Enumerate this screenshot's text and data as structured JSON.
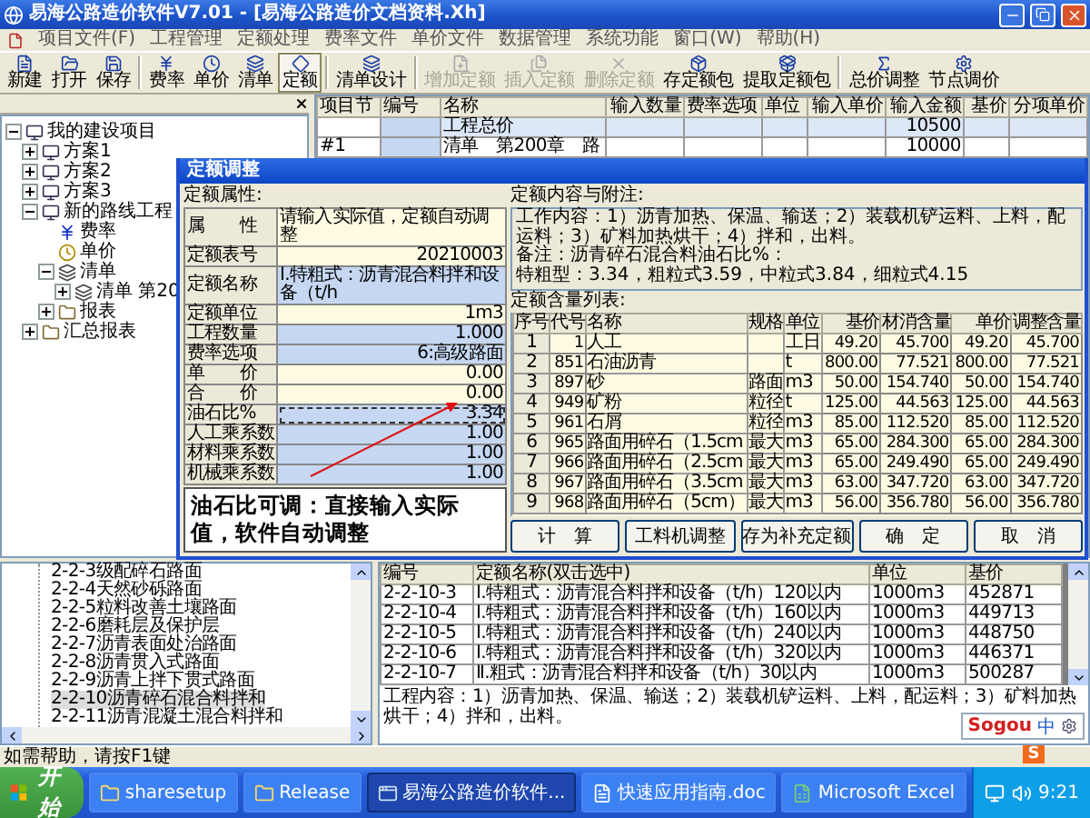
{
  "window": {
    "title": "易海公路造价软件V7.01 - [易海公路造价文档资料.Xh]"
  },
  "menu": [
    "项目文件(F)",
    "工程管理",
    "定额处理",
    "费率文件",
    "单价文件",
    "数据管理",
    "系统功能",
    "窗口(W)",
    "帮助(H)"
  ],
  "toolbar": [
    [
      {
        "label": "新建",
        "kind": "new",
        "pressed": false,
        "disabled": false
      },
      {
        "label": "打开",
        "kind": "open",
        "pressed": false,
        "disabled": false
      },
      {
        "label": "保存",
        "kind": "save",
        "pressed": false,
        "disabled": false
      }
    ],
    [
      {
        "label": "费率",
        "kind": "rate",
        "pressed": false,
        "disabled": false
      },
      {
        "label": "单价",
        "kind": "price",
        "pressed": false,
        "disabled": false
      },
      {
        "label": "清单",
        "kind": "list",
        "pressed": false,
        "disabled": false
      },
      {
        "label": "定额",
        "kind": "quota",
        "pressed": true,
        "disabled": false
      }
    ],
    [
      {
        "label": "清单设计",
        "kind": "design",
        "pressed": false,
        "disabled": false
      }
    ],
    [
      {
        "label": "增加定额",
        "kind": "add",
        "pressed": false,
        "disabled": true
      },
      {
        "label": "插入定额",
        "kind": "insert",
        "pressed": false,
        "disabled": true
      },
      {
        "label": "删除定额",
        "kind": "delete",
        "pressed": false,
        "disabled": true
      },
      {
        "label": "存定额包",
        "kind": "store",
        "pressed": false,
        "disabled": false
      },
      {
        "label": "提取定额包",
        "kind": "extract",
        "pressed": false,
        "disabled": false
      }
    ],
    [
      {
        "label": "总价调整",
        "kind": "total",
        "pressed": false,
        "disabled": false
      },
      {
        "label": "节点调价",
        "kind": "node",
        "pressed": false,
        "disabled": false
      }
    ]
  ],
  "project_tree": [
    {
      "label": "我的建设项目",
      "kind": "project",
      "expanded": true,
      "children": [
        {
          "label": "方案1",
          "kind": "project",
          "expanded": false
        },
        {
          "label": "方案2",
          "kind": "project",
          "expanded": false
        },
        {
          "label": "方案3",
          "kind": "project",
          "expanded": false
        },
        {
          "label": "新的路线工程",
          "kind": "project",
          "expanded": true,
          "children": [
            {
              "label": "费率",
              "kind": "rate"
            },
            {
              "label": "单价",
              "kind": "price"
            },
            {
              "label": "清单",
              "kind": "list",
              "expanded": true,
              "children": [
                {
                  "label": "清单 第20",
                  "kind": "list",
                  "expanded": false
                }
              ]
            },
            {
              "label": "报表",
              "kind": "folder",
              "expanded": false
            }
          ]
        },
        {
          "label": "汇总报表",
          "kind": "folder",
          "expanded": false
        }
      ]
    }
  ],
  "grid": {
    "columns": [
      "项目节",
      "编号",
      "名称",
      "输入数量",
      "费率选项",
      "单位",
      "输入单价",
      "输入金额",
      "基价",
      "分项单价"
    ],
    "rows": [
      {
        "selected": true,
        "cells": [
          "",
          "",
          "工程总价",
          "",
          "",
          "",
          "",
          "10500",
          "",
          ""
        ]
      },
      {
        "selected": false,
        "cells": [
          "#1",
          "",
          "清单　第200章　路",
          "",
          "",
          "",
          "",
          "10000",
          "",
          ""
        ]
      }
    ]
  },
  "dialog": {
    "title": "定额调整",
    "props_label": "定额属性:",
    "props_header": {
      "label": "属　　性",
      "value": "请输入实际值，定额自动调整"
    },
    "props": [
      {
        "label": "定额表号",
        "value": "20210003",
        "editable": false,
        "selected": false
      },
      {
        "label": "定额名称",
        "value": "Ⅰ.特粗式：沥青混合料拌和设备（t/h",
        "editable": true,
        "selected": false
      },
      {
        "label": "定额单位",
        "value": "1m3",
        "editable": false,
        "selected": false
      },
      {
        "label": "工程数量",
        "value": "1.000",
        "editable": true,
        "selected": false
      },
      {
        "label": "费率选项",
        "value": "6:高级路面",
        "editable": true,
        "selected": false
      },
      {
        "label": "单　　价",
        "value": "0.00",
        "editable": false,
        "selected": false
      },
      {
        "label": "合　　价",
        "value": "0.00",
        "editable": false,
        "selected": false
      },
      {
        "label": "油石比%",
        "value": "3.34",
        "editable": true,
        "selected": true
      },
      {
        "label": "人工乘系数",
        "value": "1.00",
        "editable": true,
        "selected": false
      },
      {
        "label": "材料乘系数",
        "value": "1.00",
        "editable": true,
        "selected": false
      },
      {
        "label": "机械乘系数",
        "value": "1.00",
        "editable": true,
        "selected": false
      }
    ],
    "note": "油石比可调：直接输入实际值，软件自动调整",
    "content_label": "定额内容与附注:",
    "content": [
      "工作内容：1）沥青加热、保温、输送；2）装载机铲运料、上料，配运料；3）矿料加热烘干；4）拌和，出料。",
      "备注：沥青碎石混合料油石比%：",
      "特粗型：3.34，粗粒式3.59，中粒式3.84，细粒式4.15"
    ],
    "list_label": "定额含量列表:",
    "columns": [
      "序号",
      "代号",
      "名称",
      "规格",
      "单位",
      "基价",
      "材消含量",
      "单价",
      "调整含量"
    ],
    "rows": [
      [
        "1",
        "1",
        "人工",
        "",
        "工日",
        "49.20",
        "45.700",
        "49.20",
        "45.700"
      ],
      [
        "2",
        "851",
        "石油沥青",
        "",
        "t",
        "800.00",
        "77.521",
        "800.00",
        "77.521"
      ],
      [
        "3",
        "897",
        "砂",
        "路面",
        "m3",
        "50.00",
        "154.740",
        "50.00",
        "154.740"
      ],
      [
        "4",
        "949",
        "矿粉",
        "粒径",
        "t",
        "125.00",
        "44.563",
        "125.00",
        "44.563"
      ],
      [
        "5",
        "961",
        "石屑",
        "粒径",
        "m3",
        "85.00",
        "112.520",
        "85.00",
        "112.520"
      ],
      [
        "6",
        "965",
        "路面用碎石（1.5cm",
        "最大",
        "m3",
        "65.00",
        "284.300",
        "65.00",
        "284.300"
      ],
      [
        "7",
        "966",
        "路面用碎石（2.5cm",
        "最大",
        "m3",
        "65.00",
        "249.490",
        "65.00",
        "249.490"
      ],
      [
        "8",
        "967",
        "路面用碎石（3.5cm",
        "最大",
        "m3",
        "63.00",
        "347.720",
        "63.00",
        "347.720"
      ],
      [
        "9",
        "968",
        "路面用碎石（5cm）",
        "最大",
        "m3",
        "56.00",
        "356.780",
        "56.00",
        "356.780"
      ]
    ],
    "buttons": [
      "计　算",
      "工料机调整",
      "存为补充定额",
      "确　定",
      "取　消"
    ]
  },
  "quota_tree": [
    {
      "label": "2-2-3级配碎石路面",
      "selected": false
    },
    {
      "label": "2-2-4天然砂砾路面",
      "selected": false
    },
    {
      "label": "2-2-5粒料改善土壤路面",
      "selected": false
    },
    {
      "label": "2-2-6磨耗层及保护层",
      "selected": false
    },
    {
      "label": "2-2-7沥青表面处治路面",
      "selected": false
    },
    {
      "label": "2-2-8沥青贯入式路面",
      "selected": false
    },
    {
      "label": "2-2-9沥青上拌下贯式路面",
      "selected": false
    },
    {
      "label": "2-2-10沥青碎石混合料拌和",
      "selected": true
    },
    {
      "label": "2-2-11沥青混凝土混合料拌和",
      "selected": false
    }
  ],
  "quota_table": {
    "columns": [
      "编号",
      "定额名称(双击选中)",
      "单位",
      "基价"
    ],
    "rows": [
      [
        "2-2-10-3",
        "Ⅰ.特粗式：沥青混合料拌和设备（t/h）120以内",
        "1000m3",
        "452871"
      ],
      [
        "2-2-10-4",
        "Ⅰ.特粗式：沥青混合料拌和设备（t/h）160以内",
        "1000m3",
        "449713"
      ],
      [
        "2-2-10-5",
        "Ⅰ.特粗式：沥青混合料拌和设备（t/h）240以内",
        "1000m3",
        "448750"
      ],
      [
        "2-2-10-6",
        "Ⅰ.特粗式：沥青混合料拌和设备（t/h）320以内",
        "1000m3",
        "446371"
      ],
      [
        "2-2-10-7",
        "Ⅱ.粗式：沥青混合料拌和设备（t/h）30以内",
        "1000m3",
        "500287"
      ]
    ]
  },
  "quota_description": "工程内容：1）沥青加热、保温、输送；2）装载机铲运料、上料，配运料；3）矿料加热烘干；4）拌和，出料。",
  "ime": {
    "logo": "Sogou",
    "mode": "中",
    "badge": "S"
  },
  "status_bar": "如需帮助，请按F1键",
  "taskbar": {
    "start": "开始",
    "items": [
      {
        "label": "sharesetup",
        "kind": "folder",
        "active": false
      },
      {
        "label": "Release",
        "kind": "folder",
        "active": false
      },
      {
        "label": "易海公路造价软件...",
        "kind": "app",
        "active": true
      },
      {
        "label": "快速应用指南.doc",
        "kind": "doc",
        "active": false
      },
      {
        "label": "Microsoft Excel",
        "kind": "sheet",
        "active": false
      }
    ],
    "clock": "9:21"
  }
}
